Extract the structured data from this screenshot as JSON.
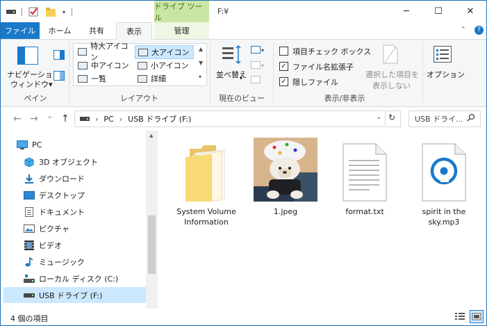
{
  "titlebar": {
    "context_tab": "ドライブ ツール",
    "window_title": "F:¥",
    "minimize": "─",
    "maximize": "☐",
    "close": "✕"
  },
  "tabs": {
    "file": "ファイル",
    "home": "ホーム",
    "share": "共有",
    "view": "表示",
    "manage": "管理"
  },
  "ribbon": {
    "pane": {
      "nav_pane_line1": "ナビゲーション",
      "nav_pane_line2": "ウィンドウ▾",
      "group": "ペイン"
    },
    "layout": {
      "items": [
        "特大アイコン",
        "大アイコン",
        "中アイコン",
        "小アイコン",
        "一覧",
        "詳細"
      ],
      "selected": "大アイコン",
      "group": "レイアウト"
    },
    "current_view": {
      "sort": "並べ替え",
      "group": "現在のビュー"
    },
    "show_hide": {
      "item_checkboxes": "項目チェック ボックス",
      "file_extensions": "ファイル名拡張子",
      "hidden_items": "隠しファイル",
      "hide_selected_line1": "選択した項目を",
      "hide_selected_line2": "表示しない",
      "group": "表示/非表示"
    },
    "options": "オプション"
  },
  "address": {
    "back": "←",
    "forward": "→",
    "recent": "⌄",
    "up": "↑",
    "path": [
      "PC",
      "USB ドライブ (F:)"
    ],
    "separator": "›",
    "search_placeholder": "USB ドライ..."
  },
  "nav_pane": {
    "items": [
      {
        "label": "PC",
        "icon": "pc-icon"
      },
      {
        "label": "3D オブジェクト",
        "icon": "3d-objects-icon"
      },
      {
        "label": "ダウンロード",
        "icon": "download-icon"
      },
      {
        "label": "デスクトップ",
        "icon": "desktop-icon"
      },
      {
        "label": "ドキュメント",
        "icon": "document-icon"
      },
      {
        "label": "ピクチャ",
        "icon": "pictures-icon"
      },
      {
        "label": "ビデオ",
        "icon": "video-icon"
      },
      {
        "label": "ミュージック",
        "icon": "music-icon"
      },
      {
        "label": "ローカル ディスク (C:)",
        "icon": "local-disk-icon"
      },
      {
        "label": "USB ドライブ (F:)",
        "icon": "usb-drive-icon"
      }
    ],
    "selected_index": 9
  },
  "files": [
    {
      "name": "System Volume Information",
      "icon": "folder-icon"
    },
    {
      "name": "1.jpeg",
      "icon": "image-thumbnail"
    },
    {
      "name": "format.txt",
      "icon": "text-file-icon"
    },
    {
      "name": "spirit in the sky.mp3",
      "icon": "audio-file-icon"
    }
  ],
  "status": {
    "item_count": "4 個の項目"
  },
  "colors": {
    "accent": "#1979ca",
    "context_tab": "#c9e6a5",
    "selection": "#cce8ff"
  }
}
